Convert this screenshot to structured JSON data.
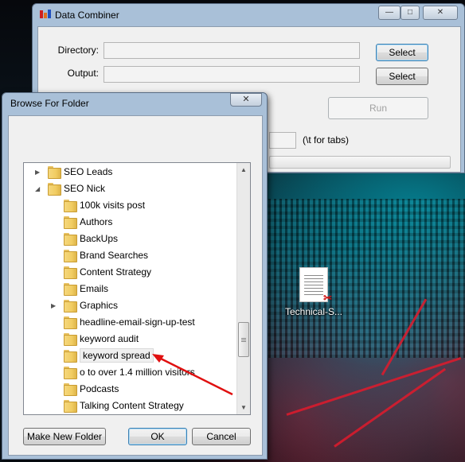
{
  "main_window": {
    "title": "Data Combiner",
    "directory_label": "Directory:",
    "output_label": "Output:",
    "select_directory_button": "Select",
    "select_output_button": "Select",
    "run_button": "Run",
    "separator_hint": "(\\t for tabs)",
    "minimize_glyph": "—",
    "maximize_glyph": "□",
    "close_glyph": "✕"
  },
  "browse_dialog": {
    "title": "Browse For Folder",
    "close_glyph": "✕",
    "tree": [
      {
        "label": "SEO Leads",
        "level": 0,
        "expander": "▶"
      },
      {
        "label": "SEO Nick",
        "level": 0,
        "expander": "◢"
      },
      {
        "label": "100k visits post",
        "level": 1,
        "expander": ""
      },
      {
        "label": "Authors",
        "level": 1,
        "expander": ""
      },
      {
        "label": "BackUps",
        "level": 1,
        "expander": ""
      },
      {
        "label": "Brand Searches",
        "level": 1,
        "expander": ""
      },
      {
        "label": "Content Strategy",
        "level": 1,
        "expander": ""
      },
      {
        "label": "Emails",
        "level": 1,
        "expander": ""
      },
      {
        "label": "Graphics",
        "level": 1,
        "expander": "▶"
      },
      {
        "label": "headline-email-sign-up-test",
        "level": 1,
        "expander": ""
      },
      {
        "label": "keyword audit",
        "level": 1,
        "expander": ""
      },
      {
        "label": "keyword spread",
        "level": 1,
        "expander": "",
        "selected": true
      },
      {
        "label": "o to over 1.4 million visitors",
        "level": 1,
        "expander": ""
      },
      {
        "label": "Podcasts",
        "level": 1,
        "expander": ""
      },
      {
        "label": "Talking Content Strategy",
        "level": 1,
        "expander": ""
      }
    ],
    "make_new_folder_button": "Make New Folder",
    "ok_button": "OK",
    "cancel_button": "Cancel",
    "scroll_up_glyph": "▲",
    "scroll_down_glyph": "▼"
  },
  "desktop": {
    "icon_label": "Technical-S...",
    "icon_badge": "✂"
  },
  "colors": {
    "window_frame": "#a9c0d8",
    "client_bg": "#f0f0f0",
    "arrow": "#e01010"
  },
  "icons": [
    "app-icon",
    "folder-icon",
    "expand-arrow-icon",
    "collapse-arrow-icon",
    "pdf-file-icon",
    "close-icon",
    "minimize-icon",
    "maximize-icon"
  ]
}
